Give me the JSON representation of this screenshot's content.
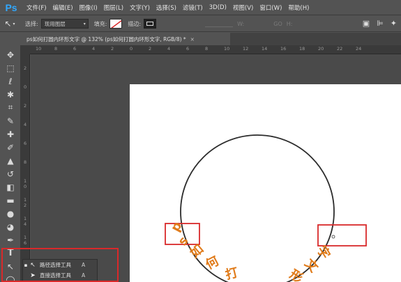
{
  "app": {
    "logo": "Ps",
    "menus": [
      "文件(F)",
      "编辑(E)",
      "图像(I)",
      "图层(L)",
      "文字(Y)",
      "选择(S)",
      "滤镜(T)",
      "3D(D)",
      "视图(V)",
      "窗口(W)",
      "帮助(H)"
    ]
  },
  "options": {
    "select_label": "选择:",
    "select_value": "现用图层",
    "fill_label": "填充:",
    "stroke_label": "描边:",
    "w_label": "W:",
    "h_label": "H:",
    "go_label": "GO"
  },
  "document": {
    "tab_title": "ps如何打圆内环形文字 @ 132% (ps如何打圆内环形文字, RGB/8) *",
    "close": "×"
  },
  "ruler": {
    "top": [
      "10",
      "8",
      "6",
      "4",
      "2",
      "0",
      "2",
      "4",
      "6",
      "8",
      "10",
      "12",
      "14",
      "16",
      "18",
      "20",
      "22",
      "24"
    ],
    "left": [
      "2",
      "0",
      "2",
      "4",
      "6",
      "8",
      "1 0",
      "1 2",
      "1 4",
      "1 6"
    ]
  },
  "canvas_text": {
    "left_glyphs": [
      "p",
      "s",
      "如",
      "何",
      "打"
    ],
    "right_glyphs": [
      "字",
      "文",
      "形"
    ],
    "text_color": "#e07b1a",
    "circle_color": "#2b2b2b",
    "highlight_color": "#d9292a"
  },
  "flyout": {
    "items": [
      {
        "label": "路径选择工具",
        "key": "A",
        "selected": true
      },
      {
        "label": "直接选择工具",
        "key": "A",
        "selected": false
      }
    ]
  },
  "tools": [
    "move-icon",
    "marquee-icon",
    "lasso-icon",
    "magic-wand-icon",
    "crop-icon",
    "eyedropper-icon",
    "healing-icon",
    "brush-icon",
    "stamp-icon",
    "history-brush-icon",
    "eraser-icon",
    "gradient-icon",
    "blur-icon",
    "dodge-icon",
    "pen-icon",
    "type-icon",
    "path-select-icon",
    "ellipse-icon"
  ]
}
